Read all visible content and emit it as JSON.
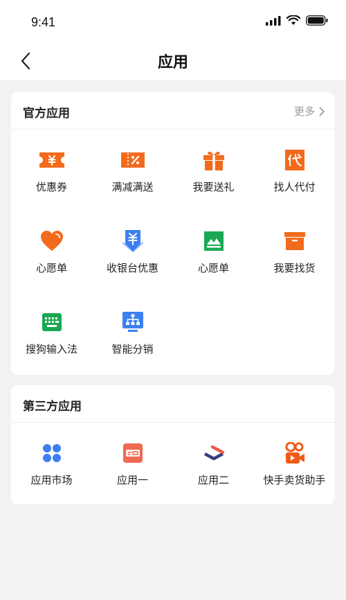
{
  "status_bar": {
    "time": "9:41"
  },
  "nav": {
    "title": "应用"
  },
  "official": {
    "title": "官方应用",
    "more": "更多",
    "items": [
      {
        "label": "优惠券",
        "icon": "coupon-icon"
      },
      {
        "label": "满减满送",
        "icon": "discount-icon"
      },
      {
        "label": "我要送礼",
        "icon": "gift-icon"
      },
      {
        "label": "找人代付",
        "icon": "pay-for-me-icon"
      },
      {
        "label": "心愿单",
        "icon": "heart-icon"
      },
      {
        "label": "收银台优惠",
        "icon": "cashier-icon"
      },
      {
        "label": "心愿单",
        "icon": "mountain-image-icon"
      },
      {
        "label": "我要找货",
        "icon": "box-icon"
      },
      {
        "label": "搜狗输入法",
        "icon": "keyboard-icon"
      },
      {
        "label": "智能分销",
        "icon": "distribution-icon"
      }
    ]
  },
  "third_party": {
    "title": "第三方应用",
    "items": [
      {
        "label": "应用市场",
        "icon": "app-market-icon"
      },
      {
        "label": "应用一",
        "icon": "app-one-icon"
      },
      {
        "label": "应用二",
        "icon": "app-two-icon"
      },
      {
        "label": "快手卖货助手",
        "icon": "kuaishou-icon"
      }
    ]
  },
  "colors": {
    "orange": "#f26b1d",
    "blue": "#3d7ff0",
    "green": "#19a851",
    "navy": "#3b3f7a",
    "background": "#f2f2f4"
  }
}
